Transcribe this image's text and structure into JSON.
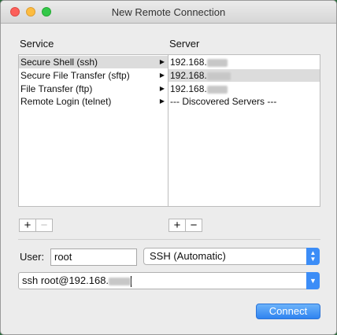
{
  "window": {
    "title": "New Remote Connection"
  },
  "service": {
    "header": "Service",
    "items": [
      {
        "label": "Secure Shell (ssh)",
        "selected": true
      },
      {
        "label": "Secure File Transfer (sftp)",
        "selected": false
      },
      {
        "label": "File Transfer (ftp)",
        "selected": false
      },
      {
        "label": "Remote Login (telnet)",
        "selected": false
      }
    ]
  },
  "server": {
    "header": "Server",
    "items": [
      {
        "label": "192.168.",
        "selected": false
      },
      {
        "label": "192.168.",
        "selected": true
      },
      {
        "label": "192.168.",
        "selected": false
      },
      {
        "label": "--- Discovered Servers ---",
        "selected": false
      }
    ]
  },
  "buttons": {
    "plus": "+",
    "minus": "−",
    "connect": "Connect"
  },
  "form": {
    "user_label": "User:",
    "user_value": "root",
    "protocol_value": "SSH (Automatic)",
    "command_value": "ssh root@192.168."
  },
  "colors": {
    "accent": "#3c8df7"
  }
}
